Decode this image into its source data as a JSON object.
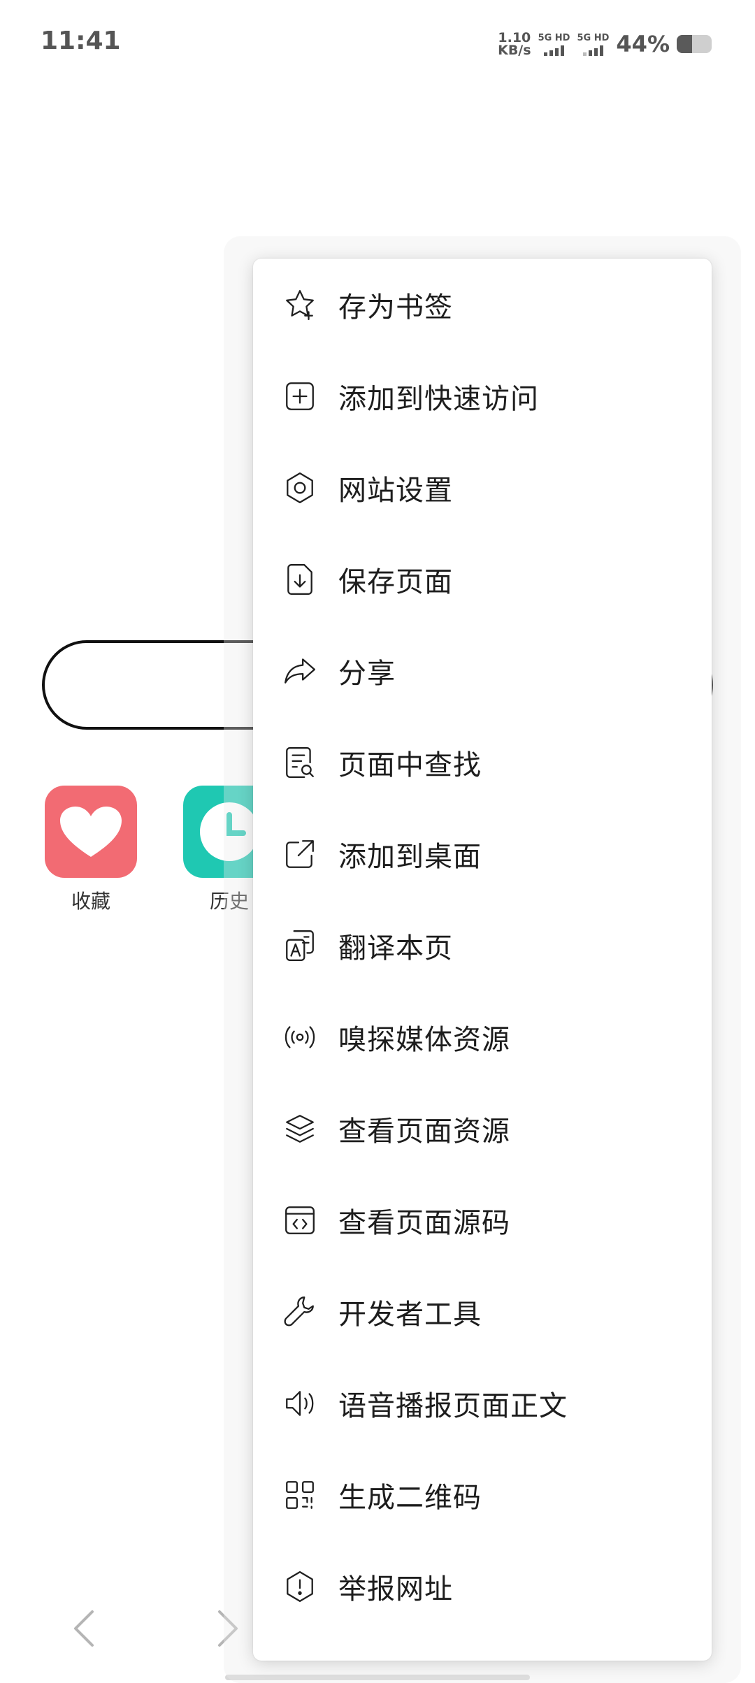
{
  "status_bar": {
    "time": "11:41",
    "net_speed_value": "1.10",
    "net_speed_unit": "KB/s",
    "sim1": "5G HD",
    "sim2": "5G HD",
    "battery_percent": "44%",
    "battery_level": 0.44
  },
  "page": {
    "quick_access": [
      {
        "label": "收藏",
        "icon": "heart-icon",
        "color": "#F26B73"
      },
      {
        "label": "历史",
        "icon": "clock-icon",
        "color": "#1FC8B2"
      }
    ],
    "nav": {
      "back_icon": "chevron-left-icon",
      "forward_icon": "chevron-right-icon"
    }
  },
  "menu": {
    "items": [
      {
        "label": "存为书签",
        "icon": "star-plus-icon"
      },
      {
        "label": "添加到快速访问",
        "icon": "plus-square-icon"
      },
      {
        "label": "网站设置",
        "icon": "gear-icon"
      },
      {
        "label": "保存页面",
        "icon": "file-download-icon"
      },
      {
        "label": "分享",
        "icon": "share-arrow-icon"
      },
      {
        "label": "页面中查找",
        "icon": "find-in-page-icon"
      },
      {
        "label": "添加到桌面",
        "icon": "external-link-icon"
      },
      {
        "label": "翻译本页",
        "icon": "translate-icon"
      },
      {
        "label": "嗅探媒体资源",
        "icon": "broadcast-icon"
      },
      {
        "label": "查看页面资源",
        "icon": "layers-icon"
      },
      {
        "label": "查看页面源码",
        "icon": "code-window-icon"
      },
      {
        "label": "开发者工具",
        "icon": "wrench-icon"
      },
      {
        "label": "语音播报页面正文",
        "icon": "speaker-icon"
      },
      {
        "label": "生成二维码",
        "icon": "qr-code-icon"
      },
      {
        "label": "举报网址",
        "icon": "shield-alert-icon"
      }
    ]
  },
  "colors": {
    "menu_text": "#1D1D1D",
    "status_text": "#555555"
  }
}
